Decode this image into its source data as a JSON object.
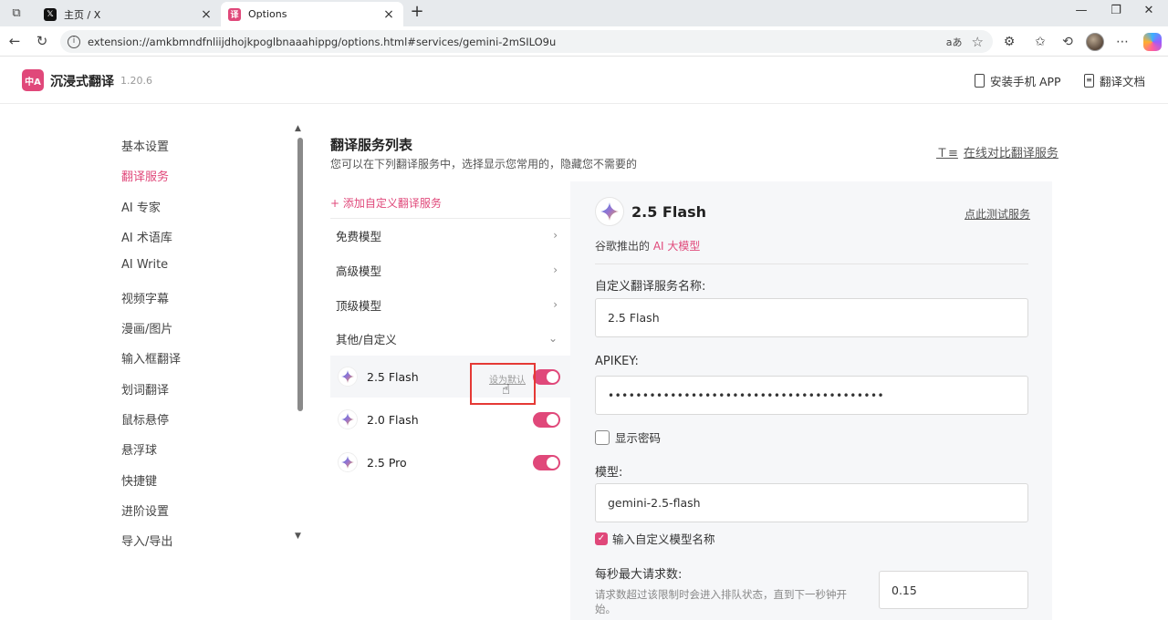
{
  "browser": {
    "tabs": [
      {
        "title": "主页 / X",
        "icon": "x-logo-icon"
      },
      {
        "title": "Options",
        "icon": "immersive-translate-icon"
      }
    ],
    "url": "extension://amkbmndfnliijdhojkpoglbnaaahippg/options.html#services/gemini-2mSILO9u",
    "read_aloud_label": "aあ"
  },
  "app": {
    "logo_text": "中A",
    "brand": "沉浸式翻译",
    "version": "1.20.6",
    "install_app": "安装手机 APP",
    "docs": "翻译文档",
    "accent_color": "#e0487a"
  },
  "sidebar": {
    "items": [
      {
        "label": "基本设置",
        "active": false
      },
      {
        "label": "翻译服务",
        "active": true
      },
      {
        "label": "AI 专家",
        "active": false
      },
      {
        "label": "AI 术语库",
        "active": false
      },
      {
        "label": "AI Write",
        "active": false
      },
      {
        "label": "视频字幕",
        "active": false
      },
      {
        "label": "漫画/图片",
        "active": false
      },
      {
        "label": "输入框翻译",
        "active": false
      },
      {
        "label": "划词翻译",
        "active": false
      },
      {
        "label": "鼠标悬停",
        "active": false
      },
      {
        "label": "悬浮球",
        "active": false
      },
      {
        "label": "快捷键",
        "active": false
      },
      {
        "label": "进阶设置",
        "active": false
      },
      {
        "label": "导入/导出",
        "active": false
      }
    ]
  },
  "main": {
    "title": "翻译服务列表",
    "subtitle": "您可以在下列翻译服务中，选择显示您常用的，隐藏您不需要的",
    "compare_link": "在线对比翻译服务",
    "add_custom": "+ 添加自定义翻译服务",
    "groups": [
      {
        "label": "免费模型",
        "expanded": false
      },
      {
        "label": "高级模型",
        "expanded": false
      },
      {
        "label": "顶级模型",
        "expanded": false
      },
      {
        "label": "其他/自定义",
        "expanded": true
      }
    ],
    "services": [
      {
        "name": "2.5 Flash",
        "enabled": true,
        "set_default_label": "设为默认"
      },
      {
        "name": "2.0 Flash",
        "enabled": true
      },
      {
        "name": "2.5 Pro",
        "enabled": true
      }
    ]
  },
  "detail": {
    "title": "2.5 Flash",
    "test_link": "点此测试服务",
    "desc_prefix": "谷歌推出的 ",
    "desc_link": "AI 大模型",
    "name_label": "自定义翻译服务名称:",
    "name_value": "2.5 Flash",
    "apikey_label": "APIKEY:",
    "apikey_value": "••••••••••••••••••••••••••••••••••••••••",
    "show_password_label": "显示密码",
    "show_password_checked": false,
    "model_label": "模型:",
    "model_value": "gemini-2.5-flash",
    "custom_model_label": "输入自定义模型名称",
    "custom_model_checked": true,
    "rate_label": "每秒最大请求数:",
    "rate_help": "请求数超过该限制时会进入排队状态，直到下一秒钟开始。",
    "rate_value": "0.15"
  }
}
